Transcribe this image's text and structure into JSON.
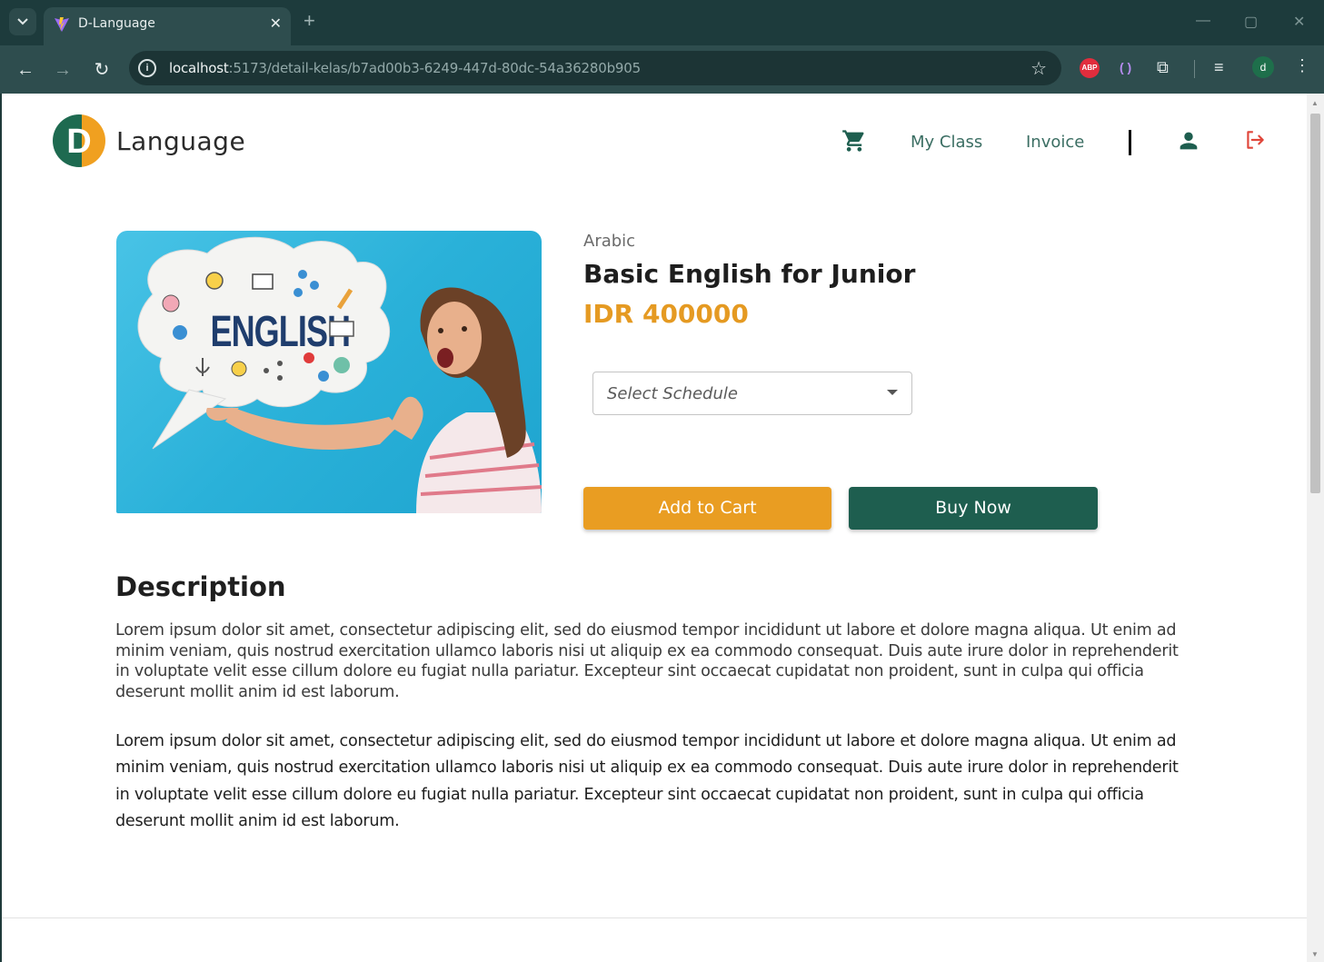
{
  "browser": {
    "tab_title": "D-Language",
    "url_host": "localhost",
    "url_path": ":5173/detail-kelas/b7ad00b3-6249-447d-80dc-54a36280b905",
    "profile_initial": "d",
    "abp_label": "ABP"
  },
  "header": {
    "brand_text": "Language",
    "logo_letter": "D",
    "nav": {
      "my_class": "My Class",
      "invoice": "Invoice"
    }
  },
  "product": {
    "category": "Arabic",
    "title": "Basic English for Junior",
    "price": "IDR 400000",
    "image_word": "ENGLISH",
    "schedule_placeholder": "Select Schedule",
    "add_to_cart_label": "Add to Cart",
    "buy_now_label": "Buy Now"
  },
  "description": {
    "heading": "Description",
    "paragraph_1": "Lorem ipsum dolor sit amet, consectetur adipiscing elit, sed do eiusmod tempor incididunt ut labore et dolore magna aliqua. Ut enim ad minim veniam, quis nostrud exercitation ullamco laboris nisi ut aliquip ex ea commodo consequat. Duis aute irure dolor in reprehenderit in voluptate velit esse cillum dolore eu fugiat nulla pariatur. Excepteur sint occaecat cupidatat non proident, sunt in culpa qui officia deserunt mollit anim id est laborum.",
    "paragraph_2": "Lorem ipsum dolor sit amet, consectetur adipiscing elit, sed do eiusmod tempor incididunt ut labore et dolore magna aliqua. Ut enim ad minim veniam, quis nostrud exercitation ullamco laboris nisi ut aliquip ex ea commodo consequat. Duis aute irure dolor in reprehenderit in voluptate velit esse cillum dolore eu fugiat nulla pariatur. Excepteur sint occaecat cupidatat non proident, sunt in culpa qui officia deserunt mollit anim id est laborum."
  },
  "colors": {
    "brand_green": "#1e5e4f",
    "accent_orange": "#e99d22",
    "nav_link": "#3b6e63",
    "logout_red": "#e0463a"
  },
  "icons": {
    "cart": "cart-icon",
    "user": "user-icon",
    "logout": "logout-icon"
  }
}
